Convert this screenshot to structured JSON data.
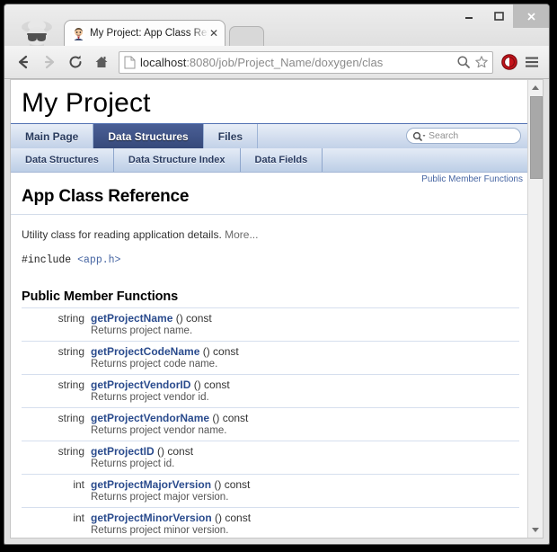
{
  "browser": {
    "window_controls": {
      "minimize": "–",
      "maximize": "☐",
      "close": "✕"
    },
    "incognito_icon": "incognito-spy-icon",
    "tab": {
      "title": "My Project: App Class Ref",
      "favicon": "doxygen-face-favicon",
      "close_label": "✕"
    },
    "new_tab_label": "",
    "toolbar": {
      "back": "←",
      "forward": "→",
      "reload": "↻",
      "home": "⌂",
      "url_host": "localhost",
      "url_rest": ":8080/job/Project_Name/doxygen/clas",
      "url_full": "localhost:8080/job/Project_Name/doxygen/clas",
      "zoom_icon": "search-zoom-icon",
      "bookmark_icon": "star-icon",
      "extension_icon": "adblock-icon",
      "menu_icon": "hamburger-menu-icon"
    }
  },
  "doxygen": {
    "project_name": "My Project",
    "main_tabs": [
      {
        "label": "Main Page",
        "active": false
      },
      {
        "label": "Data Structures",
        "active": true
      },
      {
        "label": "Files",
        "active": false
      }
    ],
    "search": {
      "placeholder": "Search",
      "icon": "magnifier-icon"
    },
    "sub_tabs": [
      {
        "label": "Data Structures"
      },
      {
        "label": "Data Structure Index"
      },
      {
        "label": "Data Fields"
      }
    ],
    "summary_links": [
      {
        "label": "Public Member Functions"
      }
    ],
    "page_title": "App Class Reference",
    "brief": "Utility class for reading application details.",
    "more_label": "More...",
    "include_prefix": "#include ",
    "include_header": "<app.h>",
    "section_title": "Public Member Functions",
    "members": [
      {
        "type": "string",
        "name": "getProjectName",
        "args": " () const",
        "desc": "Returns project name."
      },
      {
        "type": "string",
        "name": "getProjectCodeName",
        "args": " () const",
        "desc": "Returns project code name."
      },
      {
        "type": "string",
        "name": "getProjectVendorID",
        "args": " () const",
        "desc": "Returns project vendor id."
      },
      {
        "type": "string",
        "name": "getProjectVendorName",
        "args": " () const",
        "desc": "Returns project vendor name."
      },
      {
        "type": "string",
        "name": "getProjectID",
        "args": " () const",
        "desc": "Returns project id."
      },
      {
        "type": "int",
        "name": "getProjectMajorVersion",
        "args": " () const",
        "desc": "Returns project major version."
      },
      {
        "type": "int",
        "name": "getProjectMinorVersion",
        "args": " () const",
        "desc": "Returns project minor version."
      }
    ]
  },
  "colors": {
    "tab_active_bg": "#3d5189",
    "tab_bar_bg": "#c2d1e8",
    "link": "#2a4b8d",
    "summary_link": "#4665a2"
  }
}
